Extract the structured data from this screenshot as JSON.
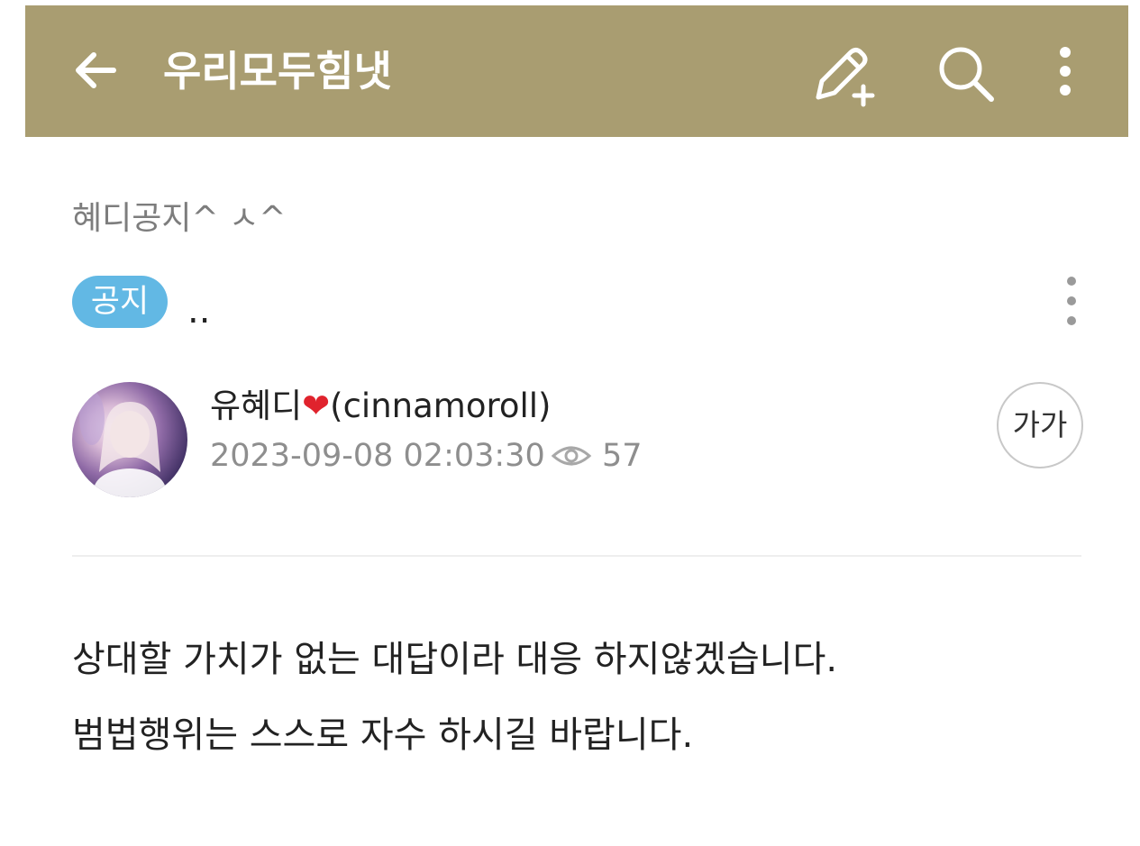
{
  "header": {
    "title": "우리모두힘냇",
    "back_icon": "arrow-left-icon",
    "write_icon": "pencil-plus-icon",
    "search_icon": "search-icon",
    "more_icon": "vertical-ellipsis-icon",
    "background_color": "#a99d71"
  },
  "post": {
    "board_name": "혜디공지^ ㅅ^",
    "badge": "공지",
    "badge_color": "#62b8e4",
    "title": "..",
    "menu_icon": "vertical-ellipsis-icon",
    "author": {
      "name_prefix": "유혜디",
      "heart": "❤",
      "name_suffix": "(cinnamoroll)",
      "avatar": "profile-photo"
    },
    "date": "2023-09-08 02:03:30",
    "view_icon": "eye-icon",
    "views": "57",
    "font_size_button": "가가",
    "body": [
      "상대할 가치가 없는 대답이라 대응 하지않겠습니다.",
      "범법행위는 스스로 자수 하시길 바랍니다."
    ]
  }
}
